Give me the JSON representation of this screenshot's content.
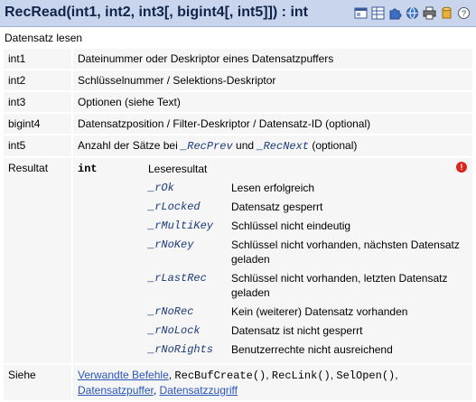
{
  "header": {
    "title": "RecRead(int1, int2, int3[, bigint4[, int5]]) : int",
    "icons": [
      "window-icon",
      "grid-icon",
      "puzzle-icon",
      "globe-icon",
      "printer-icon",
      "database-icon",
      "help-icon"
    ]
  },
  "subtitle": "Datensatz lesen",
  "params": [
    {
      "name": "int1",
      "desc": "Dateinummer oder Deskriptor eines Datensatzpuffers"
    },
    {
      "name": "int2",
      "desc": "Schlüsselnummer / Selektions-Deskriptor"
    },
    {
      "name": "int3",
      "desc": "Optionen (siehe Text)"
    },
    {
      "name": "bigint4",
      "desc": "Datensatzposition / Filter-Deskriptor / Datensatz-ID (optional)"
    }
  ],
  "int5": {
    "name": "int5",
    "prefix": "Anzahl der Sätze bei ",
    "c1": "_RecPrev",
    "mid": " und ",
    "c2": "_RecNext",
    "suffix": " (optional)"
  },
  "result": {
    "label": "Resultat",
    "type": "int",
    "heading": "Leseresultat",
    "warn_symbol": "!",
    "rows": [
      {
        "code": "_rOk",
        "text": "Lesen erfolgreich"
      },
      {
        "code": "_rLocked",
        "text": "Datensatz gesperrt"
      },
      {
        "code": "_rMultiKey",
        "text": "Schlüssel nicht eindeutig"
      },
      {
        "code": "_rNoKey",
        "text": "Schlüssel nicht vorhanden, nächsten Datensatz geladen"
      },
      {
        "code": "_rLastRec",
        "text": "Schlüssel nicht vorhanden, letzten Datensatz geladen"
      },
      {
        "code": "_rNoRec",
        "text": "Kein (weiterer) Datensatz vorhanden"
      },
      {
        "code": "_rNoLock",
        "text": "Datensatz ist nicht gesperrt"
      },
      {
        "code": "_rNoRights",
        "text": "Benutzerrechte nicht ausreichend"
      }
    ]
  },
  "siehe": {
    "label": "Siehe",
    "link1": "Verwandte Befehle",
    "sep1": ", ",
    "code1": "RecBufCreate()",
    "sep2": ", ",
    "code2": "RecLink()",
    "sep3": ", ",
    "code3": "SelOpen()",
    "sep4": ",",
    "link2": "Datensatzpuffer",
    "sep5": ", ",
    "link3": "Datensatzzugriff"
  },
  "colors": {
    "header_bg": "#c8d5ec",
    "title": "#10244a",
    "row_bg": "#f6f6f6",
    "link": "#2854b8",
    "code_italic": "#1a3a7a",
    "warn": "#d8281e"
  }
}
